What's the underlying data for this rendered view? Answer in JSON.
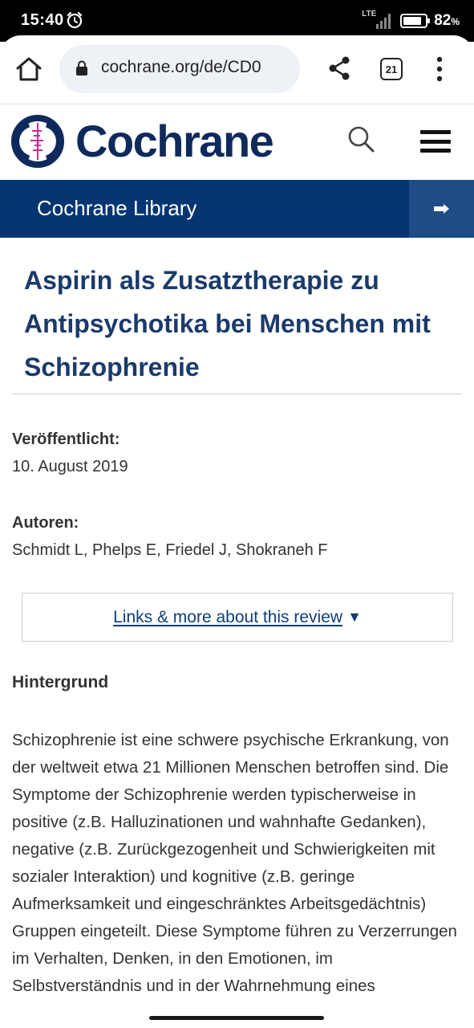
{
  "status_bar": {
    "time": "15:40",
    "network": "LTE",
    "battery_percent": "82",
    "battery_unit": "%",
    "battery_level": 0.82,
    "icons": [
      "alarm-icon",
      "signal-icon",
      "battery-icon"
    ]
  },
  "browser": {
    "url": "cochrane.org/de/CD0",
    "tab_count": "21",
    "icons": [
      "home-icon",
      "lock-icon",
      "share-icon",
      "tabs-icon",
      "more-vert-icon"
    ]
  },
  "site": {
    "brand": "Cochrane",
    "library_link": "Cochrane Library",
    "icons": [
      "cochrane-logo",
      "search-icon",
      "hamburger-menu-icon",
      "arrow-right-icon"
    ],
    "colors": {
      "brand_navy": "#0e2a5c",
      "library_bar": "#043573",
      "library_arrow": "#1f4b86",
      "logo_magenta": "#c2318f"
    }
  },
  "article": {
    "title": "Aspirin als Zusatztherapie zu Antipsychotika bei Menschen mit Schizophrenie",
    "published_label": "Veröffentlicht:",
    "published_date": "10. August 2019",
    "authors_label": "Autoren:",
    "authors": "Schmidt L, Phelps E, Friedel J, Shokraneh F",
    "links_label": "Links & more about this review",
    "links_caret": "▼",
    "section_heading": "Hintergrund",
    "body": "Schizophrenie ist eine schwere psychische Erkrankung, von der weltweit etwa 21 Millionen Menschen betroffen sind. Die Symptome der Schizophrenie werden typischerweise in positive (z.B. Halluzinationen und wahnhafte Gedanken), negative (z.B. Zurückgezogenheit und Schwierigkeiten mit sozialer Interaktion) und kognitive (z.B. geringe Aufmerksamkeit und eingeschränktes Arbeitsgedächtnis) Gruppen eingeteilt. Diese Symptome führen zu Verzerrungen im Verhalten, Denken, in den Emotionen, im Selbstverständnis und in der Wahrnehmung eines"
  }
}
